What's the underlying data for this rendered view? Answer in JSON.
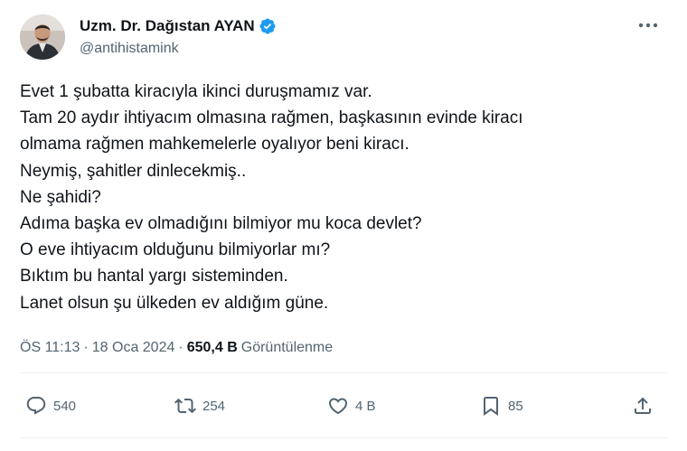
{
  "author": {
    "display_name": "Uzm. Dr. Dağıstan AYAN",
    "handle": "@antihistamink",
    "verified": true,
    "verified_color": "#1d9bf0"
  },
  "tweet": {
    "lines": [
      "Evet 1 şubatta kiracıyla ikinci duruşmamız var.",
      "Tam 20 aydır ihtiyacım olmasına rağmen, başkasının evinde kiracı",
      "olmama rağmen mahkemelerle oyalıyor beni kiracı.",
      "Neymiş, şahitler dinlecekmiş..",
      "Ne şahidi?",
      "Adıma başka ev olmadığını bilmiyor mu koca devlet?",
      "O eve ihtiyacım olduğunu bilmiyorlar mı?",
      "Bıktım bu hantal yargı sisteminden.",
      "Lanet olsun şu ülkeden ev aldığım güne."
    ]
  },
  "meta": {
    "time": "ÖS 11:13",
    "separator": "·",
    "date": "18 Oca 2024",
    "views_count": "650,4 B",
    "views_label": "Görüntülenme"
  },
  "actions": {
    "replies": "540",
    "reposts": "254",
    "likes": "4 B",
    "bookmarks": "85"
  },
  "icons": [
    "more-icon",
    "verified-icon",
    "reply-icon",
    "repost-icon",
    "like-icon",
    "bookmark-icon",
    "share-icon"
  ],
  "colors": {
    "text": "#0f1419",
    "secondary": "#536471",
    "divider": "#eff3f4",
    "accent": "#1d9bf0"
  }
}
